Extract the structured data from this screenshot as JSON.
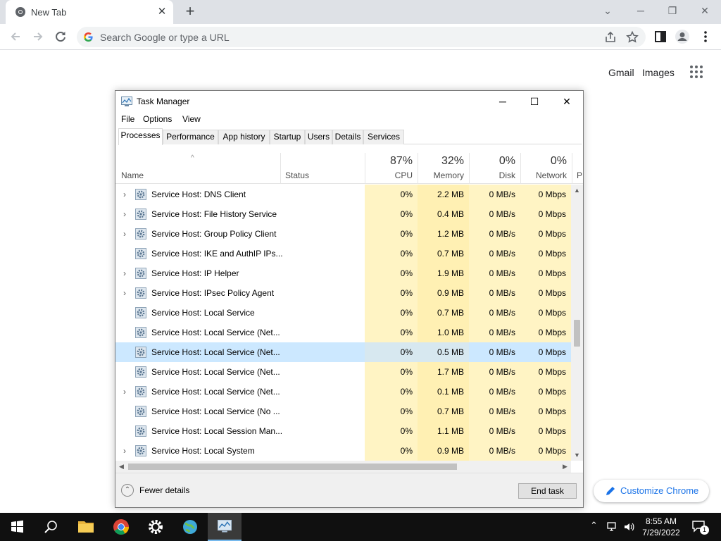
{
  "chrome": {
    "tab_title": "New Tab",
    "tab_close": "✕",
    "new_tab": "+",
    "omnibox_placeholder": "Search Google or type a URL",
    "win_minimize": "─",
    "win_restore": "❐",
    "win_close": "✕",
    "win_tabsearch": "⌄"
  },
  "ntp": {
    "gmail": "Gmail",
    "images": "Images",
    "customize": "Customize Chrome"
  },
  "task_manager": {
    "title": "Task Manager",
    "minimize": "─",
    "maximize": "☐",
    "close": "✕",
    "menu": [
      "File",
      "Options",
      "View"
    ],
    "tabs": [
      "Processes",
      "Performance",
      "App history",
      "Startup",
      "Users",
      "Details",
      "Services"
    ],
    "active_tab": "Processes",
    "columns": {
      "name": "Name",
      "status": "Status",
      "cpu_pct": "87%",
      "cpu": "CPU",
      "mem_pct": "32%",
      "mem": "Memory",
      "disk_pct": "0%",
      "disk": "Disk",
      "net_pct": "0%",
      "net": "Network",
      "extra": "P"
    },
    "sort_arrow": "^",
    "rows": [
      {
        "name": "Service Host: DNS Client",
        "expandable": true,
        "cpu": "0%",
        "memory": "2.2 MB",
        "disk": "0 MB/s",
        "network": "0 Mbps"
      },
      {
        "name": "Service Host: File History Service",
        "expandable": true,
        "cpu": "0%",
        "memory": "0.4 MB",
        "disk": "0 MB/s",
        "network": "0 Mbps"
      },
      {
        "name": "Service Host: Group Policy Client",
        "expandable": true,
        "cpu": "0%",
        "memory": "1.2 MB",
        "disk": "0 MB/s",
        "network": "0 Mbps"
      },
      {
        "name": "Service Host: IKE and AuthIP IPs...",
        "expandable": false,
        "cpu": "0%",
        "memory": "0.7 MB",
        "disk": "0 MB/s",
        "network": "0 Mbps"
      },
      {
        "name": "Service Host: IP Helper",
        "expandable": true,
        "cpu": "0%",
        "memory": "1.9 MB",
        "disk": "0 MB/s",
        "network": "0 Mbps"
      },
      {
        "name": "Service Host: IPsec Policy Agent",
        "expandable": true,
        "cpu": "0%",
        "memory": "0.9 MB",
        "disk": "0 MB/s",
        "network": "0 Mbps"
      },
      {
        "name": "Service Host: Local Service",
        "expandable": false,
        "cpu": "0%",
        "memory": "0.7 MB",
        "disk": "0 MB/s",
        "network": "0 Mbps"
      },
      {
        "name": "Service Host: Local Service (Net...",
        "expandable": false,
        "cpu": "0%",
        "memory": "1.0 MB",
        "disk": "0 MB/s",
        "network": "0 Mbps"
      },
      {
        "name": "Service Host: Local Service (Net...",
        "expandable": false,
        "cpu": "0%",
        "memory": "0.5 MB",
        "disk": "0 MB/s",
        "network": "0 Mbps",
        "selected": true
      },
      {
        "name": "Service Host: Local Service (Net...",
        "expandable": false,
        "cpu": "0%",
        "memory": "1.7 MB",
        "disk": "0 MB/s",
        "network": "0 Mbps"
      },
      {
        "name": "Service Host: Local Service (Net...",
        "expandable": true,
        "cpu": "0%",
        "memory": "0.1 MB",
        "disk": "0 MB/s",
        "network": "0 Mbps"
      },
      {
        "name": "Service Host: Local Service (No ...",
        "expandable": false,
        "cpu": "0%",
        "memory": "0.7 MB",
        "disk": "0 MB/s",
        "network": "0 Mbps"
      },
      {
        "name": "Service Host: Local Session Man...",
        "expandable": false,
        "cpu": "0%",
        "memory": "1.1 MB",
        "disk": "0 MB/s",
        "network": "0 Mbps"
      },
      {
        "name": "Service Host: Local System",
        "expandable": true,
        "cpu": "0%",
        "memory": "0.9 MB",
        "disk": "0 MB/s",
        "network": "0 Mbps"
      }
    ],
    "fewer_details": "Fewer details",
    "end_task": "End task"
  },
  "taskbar": {
    "time": "8:55 AM",
    "date": "7/29/2022",
    "notification_count": "1",
    "apps": [
      "start-icon",
      "search-icon",
      "file-explorer-icon",
      "chrome-icon",
      "settings-icon",
      "network-globe-icon",
      "task-manager-icon"
    ]
  },
  "colors": {
    "selected_row": "#cce8ff",
    "cpu_heat": "#fff4c4",
    "mem_heat": "#fff0b3",
    "accent": "#1a73e8"
  }
}
